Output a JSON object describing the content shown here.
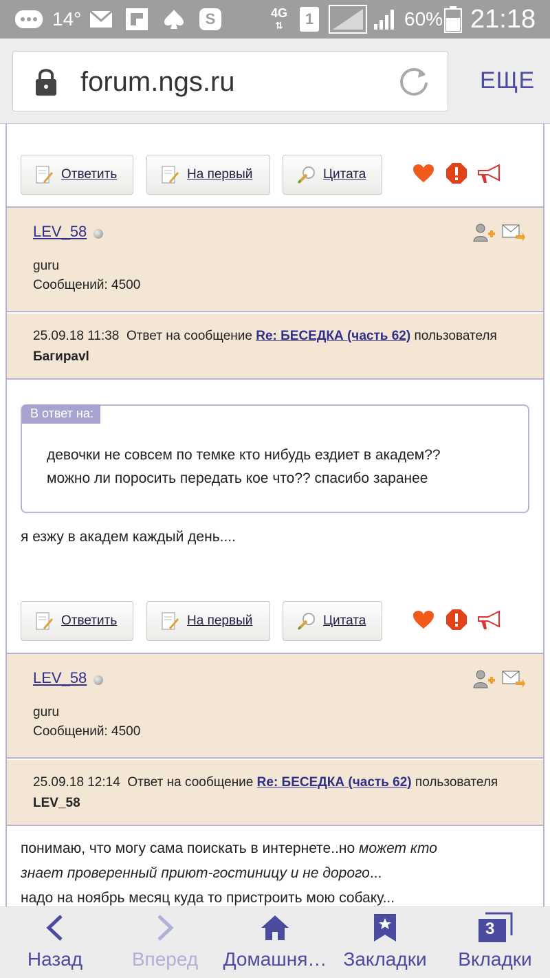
{
  "status_bar": {
    "temperature": "14°",
    "network": "4G",
    "sim": "1",
    "battery": "60%",
    "time": "21:18"
  },
  "browser": {
    "url": "forum.ngs.ru",
    "more_label": "ЕЩЕ"
  },
  "post_actions": {
    "reply": "Ответить",
    "to_first": "На первый",
    "quote": "Цитата"
  },
  "posts": [
    {
      "author": "LEV_58",
      "rank": "guru",
      "messages": "Сообщений: 4500",
      "datetime": "25.09.18 11:38",
      "reply_prefix": "Ответ на сообщение",
      "reply_link": "Re: БЕСЕДКА (часть 62)",
      "reply_suffix": "пользователя",
      "reply_user": "Багиpavl",
      "quote_label": "В ответ на:",
      "quote_line1": "девочки не совсем по темке кто нибудь ездиет в академ??",
      "quote_line2": "можно ли поросить передать кое что?? спасибо заранее",
      "body_line1": "я езжу в академ каждый день...."
    },
    {
      "author": "LEV_58",
      "rank": "guru",
      "messages": "Сообщений: 4500",
      "datetime": "25.09.18 12:14",
      "reply_prefix": "Ответ на сообщение",
      "reply_link": "Re: БЕСЕДКА (часть 62)",
      "reply_suffix": "пользователя",
      "reply_user": "LEV_58",
      "body_line1_plain": "понимаю, что могу сама поискать в интернете..но ",
      "body_line1_italic": "может кто",
      "body_line2_italic": "знает проверенный приют-гостиницу и не дорого",
      "body_line2_plain": "...",
      "body_line3": "надо на ноябрь месяц куда то пристроить мою собаку..."
    }
  ],
  "nav": {
    "back": "Назад",
    "forward": "Вперед",
    "home": "Домашня…",
    "bookmarks": "Закладки",
    "tabs": "Вкладки",
    "tabs_count": "3"
  },
  "colors": {
    "accent": "#4b4ba0",
    "panel_bg": "#f3e6d4",
    "border": "#b8b4d8",
    "status_bar": "#9e9e9e"
  }
}
